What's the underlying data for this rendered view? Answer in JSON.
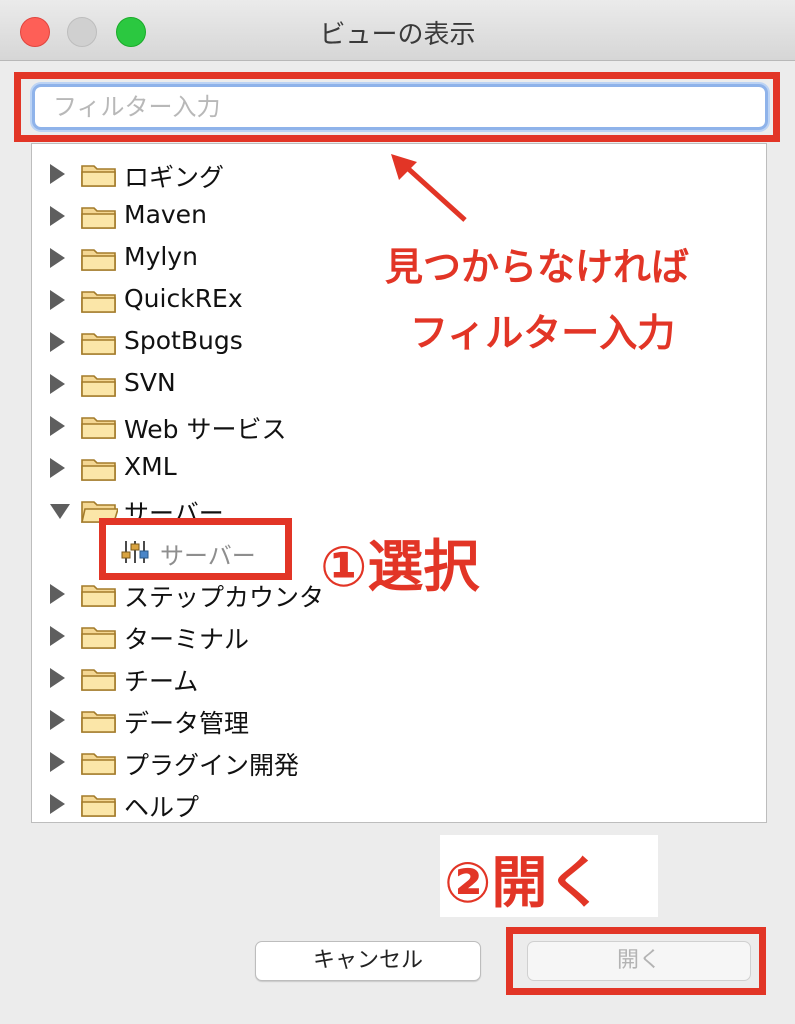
{
  "window": {
    "title": "ビューの表示"
  },
  "filter": {
    "placeholder": "フィルター入力",
    "value": ""
  },
  "tree": {
    "items": [
      {
        "label": "ロギング",
        "expanded": false
      },
      {
        "label": "Maven",
        "expanded": false
      },
      {
        "label": "Mylyn",
        "expanded": false
      },
      {
        "label": "QuickREx",
        "expanded": false
      },
      {
        "label": "SpotBugs",
        "expanded": false
      },
      {
        "label": "SVN",
        "expanded": false
      },
      {
        "label": "Web サービス",
        "expanded": false
      },
      {
        "label": "XML",
        "expanded": false
      },
      {
        "label": "サーバー",
        "expanded": true,
        "children": [
          {
            "label": "サーバー"
          }
        ]
      },
      {
        "label": "ステップカウンタ",
        "expanded": false
      },
      {
        "label": "ターミナル",
        "expanded": false
      },
      {
        "label": "チーム",
        "expanded": false
      },
      {
        "label": "データ管理",
        "expanded": false
      },
      {
        "label": "プラグイン開発",
        "expanded": false
      },
      {
        "label": "ヘルプ",
        "expanded": false
      }
    ]
  },
  "annotations": {
    "filter_line1": "見つからなければ",
    "filter_line2": "フィルター入力",
    "select": "①選択",
    "open": "②開く"
  },
  "buttons": {
    "cancel": "キャンセル",
    "open": "開く"
  },
  "colors": {
    "annotation_red": "#e23526",
    "focus_blue": "#8fb3ea"
  },
  "icons": {
    "folder": "folder-icon",
    "server_view": "server-view-icon"
  }
}
